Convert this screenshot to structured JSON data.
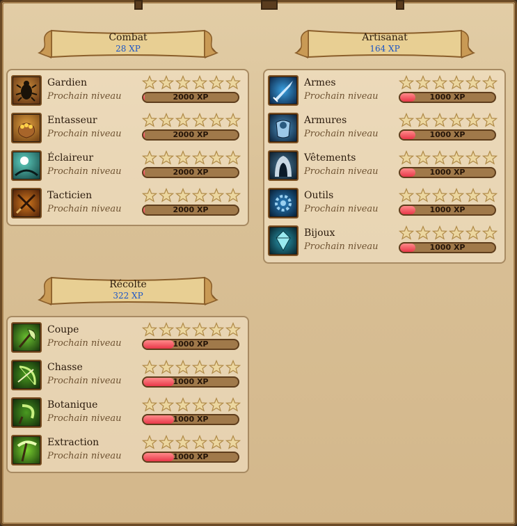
{
  "colors": {
    "xp_blue": "#1a55c8",
    "bar_fill": "#e8384a",
    "panel_border": "#a78a62"
  },
  "sections": [
    {
      "key": "combat",
      "title": "Combat",
      "xp": "28 XP",
      "skills": [
        {
          "name": "Gardien",
          "sub": "Prochain niveau",
          "stars": 0,
          "bar_text": "2000 XP",
          "progress": 0.01,
          "icon": "beetle-icon"
        },
        {
          "name": "Entasseur",
          "sub": "Prochain niveau",
          "stars": 0,
          "bar_text": "2000 XP",
          "progress": 0.01,
          "icon": "gold-sack-icon"
        },
        {
          "name": "Éclaireur",
          "sub": "Prochain niveau",
          "stars": 0,
          "bar_text": "2000 XP",
          "progress": 0.01,
          "icon": "scout-moon-icon"
        },
        {
          "name": "Tacticien",
          "sub": "Prochain niveau",
          "stars": 0,
          "bar_text": "2000 XP",
          "progress": 0.01,
          "icon": "crossed-swords-icon"
        }
      ]
    },
    {
      "key": "artisanat",
      "title": "Artisanat",
      "xp": "164 XP",
      "skills": [
        {
          "name": "Armes",
          "sub": "Prochain niveau",
          "stars": 0,
          "bar_text": "1000 XP",
          "progress": 0.16,
          "icon": "sword-icon"
        },
        {
          "name": "Armures",
          "sub": "Prochain niveau",
          "stars": 0,
          "bar_text": "1000 XP",
          "progress": 0.16,
          "icon": "armor-icon"
        },
        {
          "name": "Vêtements",
          "sub": "Prochain niveau",
          "stars": 0,
          "bar_text": "1000 XP",
          "progress": 0.16,
          "icon": "hood-icon"
        },
        {
          "name": "Outils",
          "sub": "Prochain niveau",
          "stars": 0,
          "bar_text": "1000 XP",
          "progress": 0.16,
          "icon": "gear-icon"
        },
        {
          "name": "Bijoux",
          "sub": "Prochain niveau",
          "stars": 0,
          "bar_text": "1000 XP",
          "progress": 0.16,
          "icon": "jewel-icon"
        }
      ]
    },
    {
      "key": "recolte",
      "title": "Récolte",
      "xp": "322 XP",
      "skills": [
        {
          "name": "Coupe",
          "sub": "Prochain niveau",
          "stars": 0,
          "bar_text": "1000 XP",
          "progress": 0.32,
          "icon": "axe-icon"
        },
        {
          "name": "Chasse",
          "sub": "Prochain niveau",
          "stars": 0,
          "bar_text": "1000 XP",
          "progress": 0.32,
          "icon": "bow-icon"
        },
        {
          "name": "Botanique",
          "sub": "Prochain niveau",
          "stars": 0,
          "bar_text": "1000 XP",
          "progress": 0.32,
          "icon": "sickle-icon"
        },
        {
          "name": "Extraction",
          "sub": "Prochain niveau",
          "stars": 0,
          "bar_text": "1000 XP",
          "progress": 0.32,
          "icon": "pickaxe-icon"
        }
      ]
    }
  ]
}
